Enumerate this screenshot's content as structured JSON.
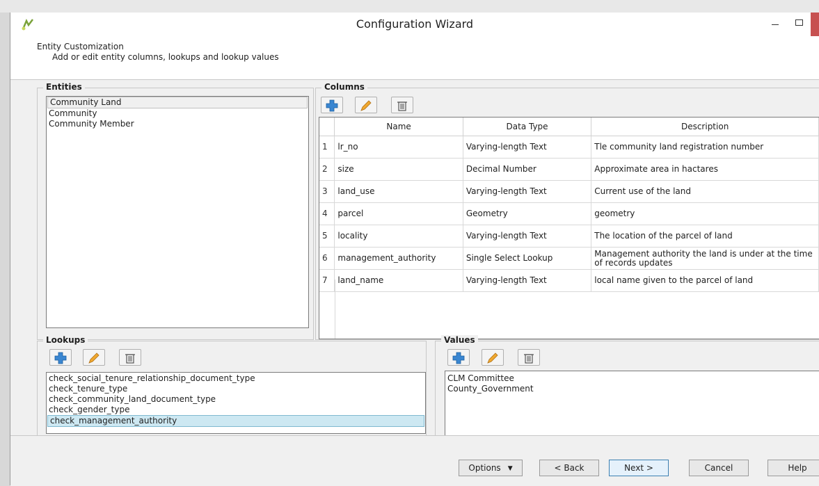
{
  "window": {
    "title": "Configuration Wizard"
  },
  "header": {
    "title": "Entity Customization",
    "subtitle": "Add or edit entity columns, lookups and lookup values"
  },
  "entities": {
    "label": "Entities",
    "items": [
      "Community Land",
      "Community",
      "Community Member"
    ],
    "selected_index": 0
  },
  "columns": {
    "label": "Columns",
    "headers": [
      "Name",
      "Data Type",
      "Description"
    ],
    "rows": [
      {
        "n": "1",
        "name": "lr_no",
        "type": "Varying-length Text",
        "desc": "Tle community land registration number"
      },
      {
        "n": "2",
        "name": "size",
        "type": "Decimal Number",
        "desc": "Approximate area in hactares"
      },
      {
        "n": "3",
        "name": "land_use",
        "type": "Varying-length Text",
        "desc": "Current use of the land"
      },
      {
        "n": "4",
        "name": "parcel",
        "type": "Geometry",
        "desc": "geometry"
      },
      {
        "n": "5",
        "name": "locality",
        "type": "Varying-length Text",
        "desc": "The location of the parcel of land"
      },
      {
        "n": "6",
        "name": "management_authority",
        "type": "Single Select Lookup",
        "desc": "Management authority the land is under at the time of records updates"
      },
      {
        "n": "7",
        "name": "land_name",
        "type": "Varying-length Text",
        "desc": "local name given to the parcel of land"
      }
    ]
  },
  "lookups": {
    "label": "Lookups",
    "items": [
      "check_social_tenure_relationship_document_type",
      "check_tenure_type",
      "check_community_land_document_type",
      "check_gender_type",
      "check_management_authority"
    ],
    "selected_index": 4
  },
  "values": {
    "label": "Values",
    "items": [
      "CLM Committee",
      "County_Government"
    ]
  },
  "footer": {
    "options": "Options",
    "back": "< Back",
    "next": "Next >",
    "cancel": "Cancel",
    "help": "Help"
  },
  "colors": {
    "selection": "#cde8f2",
    "add_icon": "#3a86d1",
    "edit_icon": "#f0a830",
    "close": "#c75050"
  }
}
